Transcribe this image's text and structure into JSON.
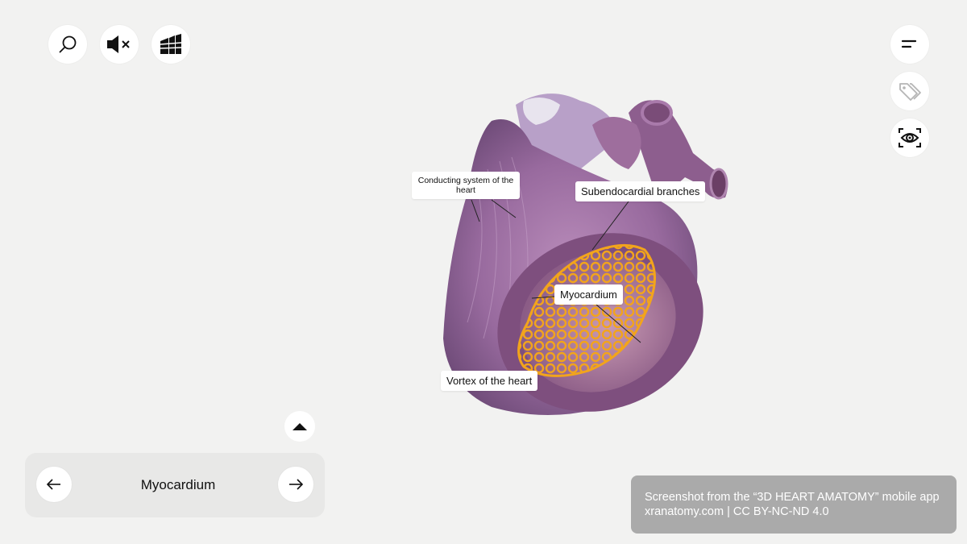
{
  "toolbar": {
    "search_icon": "search-icon",
    "mute_icon": "speaker-muted-icon",
    "layers_icon": "layers-icon"
  },
  "right_toolbar": {
    "menu_icon": "menu-icon",
    "tags_icon": "tag-icon",
    "view_icon": "eye-focus-icon"
  },
  "labels": {
    "conducting": "Conducting system of the heart",
    "subendocardial": "Subendocardial branches",
    "myocardium": "Myocardium",
    "vortex": "Vortex of the heart"
  },
  "nav": {
    "title": "Myocardium",
    "prev_icon": "arrow-left-icon",
    "next_icon": "arrow-right-icon",
    "expand_icon": "triangle-up-icon"
  },
  "credit": {
    "line1": "Screenshot from the “3D HEART AMATOMY” mobile app",
    "line2": "xranatomy.com | CC BY-NC-ND 4.0"
  },
  "colors": {
    "background": "#f2f2f1",
    "tissue": "#9a6a9e",
    "highlight": "#f2a41c"
  }
}
